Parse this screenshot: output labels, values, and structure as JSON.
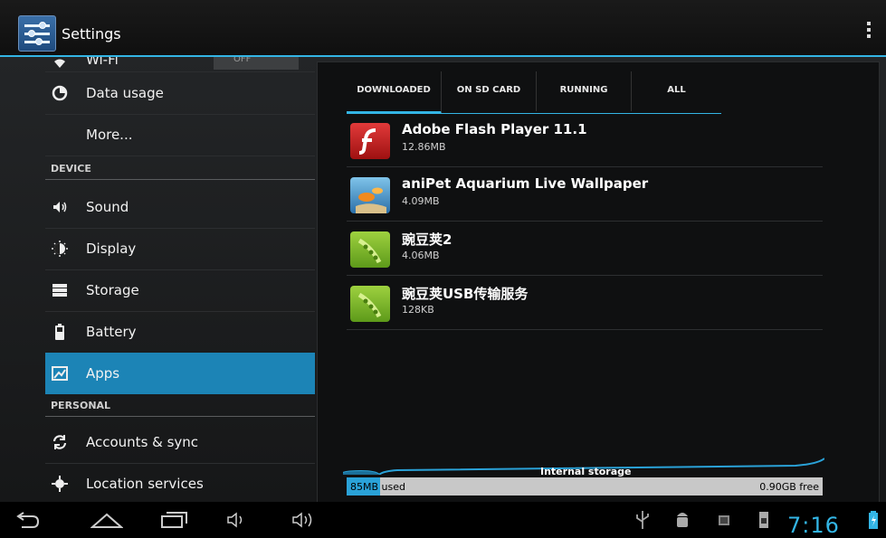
{
  "actionbar": {
    "title": "Settings"
  },
  "settings": {
    "wifi": {
      "label": "Wi-Fi",
      "toggle": "OFF"
    },
    "items_top": [
      {
        "label": "Data usage",
        "icon": "data-usage-icon"
      },
      {
        "label": "More..."
      }
    ],
    "device_header": "DEVICE",
    "device_items": [
      {
        "label": "Sound",
        "icon": "sound-icon"
      },
      {
        "label": "Display",
        "icon": "display-icon"
      },
      {
        "label": "Storage",
        "icon": "storage-icon"
      },
      {
        "label": "Battery",
        "icon": "battery-icon"
      },
      {
        "label": "Apps",
        "icon": "apps-icon",
        "selected": true
      }
    ],
    "personal_header": "PERSONAL",
    "personal_items": [
      {
        "label": "Accounts & sync",
        "icon": "sync-icon"
      },
      {
        "label": "Location services",
        "icon": "location-icon"
      }
    ]
  },
  "apps_panel": {
    "tabs": [
      {
        "label": "DOWNLOADED",
        "active": true
      },
      {
        "label": "ON SD CARD"
      },
      {
        "label": "RUNNING"
      },
      {
        "label": "ALL"
      }
    ],
    "apps": [
      {
        "name": "Adobe Flash Player 11.1",
        "size": "12.86MB",
        "icon": "flash-player-icon"
      },
      {
        "name": "aniPet Aquarium Live Wallpaper",
        "size": "4.09MB",
        "icon": "aquarium-icon"
      },
      {
        "name": "豌豆荚2",
        "size": "4.06MB",
        "icon": "pea-pod-icon"
      },
      {
        "name": "豌豆荚USB传输服务",
        "size": "128KB",
        "icon": "pea-pod-icon"
      }
    ],
    "storage": {
      "label": "Internal storage",
      "used": "85MB used",
      "free": "0.90GB free"
    }
  },
  "statusbar": {
    "time": "7:16"
  },
  "colors": {
    "accent": "#33b5e5",
    "selected": "#1c84b6",
    "flash_red": "#c41d1d",
    "pea_green": "#7fb32b"
  }
}
